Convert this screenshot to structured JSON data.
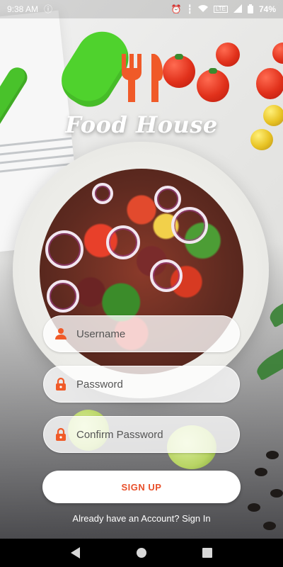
{
  "status_bar": {
    "time": "9:38 AM",
    "battery": "74%",
    "icons": [
      "notification-icon",
      "alarm-icon",
      "vibrate-icon",
      "wifi-icon",
      "volte-icon",
      "signal-icon",
      "battery-icon"
    ]
  },
  "brand": {
    "logo_icon": "fork-knife-icon",
    "title": "Food House",
    "accent_color": "#f05a28"
  },
  "form": {
    "username": {
      "placeholder": "Username",
      "value": "",
      "icon": "person-icon"
    },
    "password": {
      "placeholder": "Password",
      "value": "",
      "icon": "lock-icon"
    },
    "confirm_password": {
      "placeholder": "Confirm Password",
      "value": "",
      "icon": "lock-icon"
    },
    "signup_label": "SIGN UP",
    "signin_prompt": "Already have an Account? Sign In"
  },
  "nav_bar": {
    "buttons": [
      "back-icon",
      "home-icon",
      "recents-icon"
    ]
  }
}
